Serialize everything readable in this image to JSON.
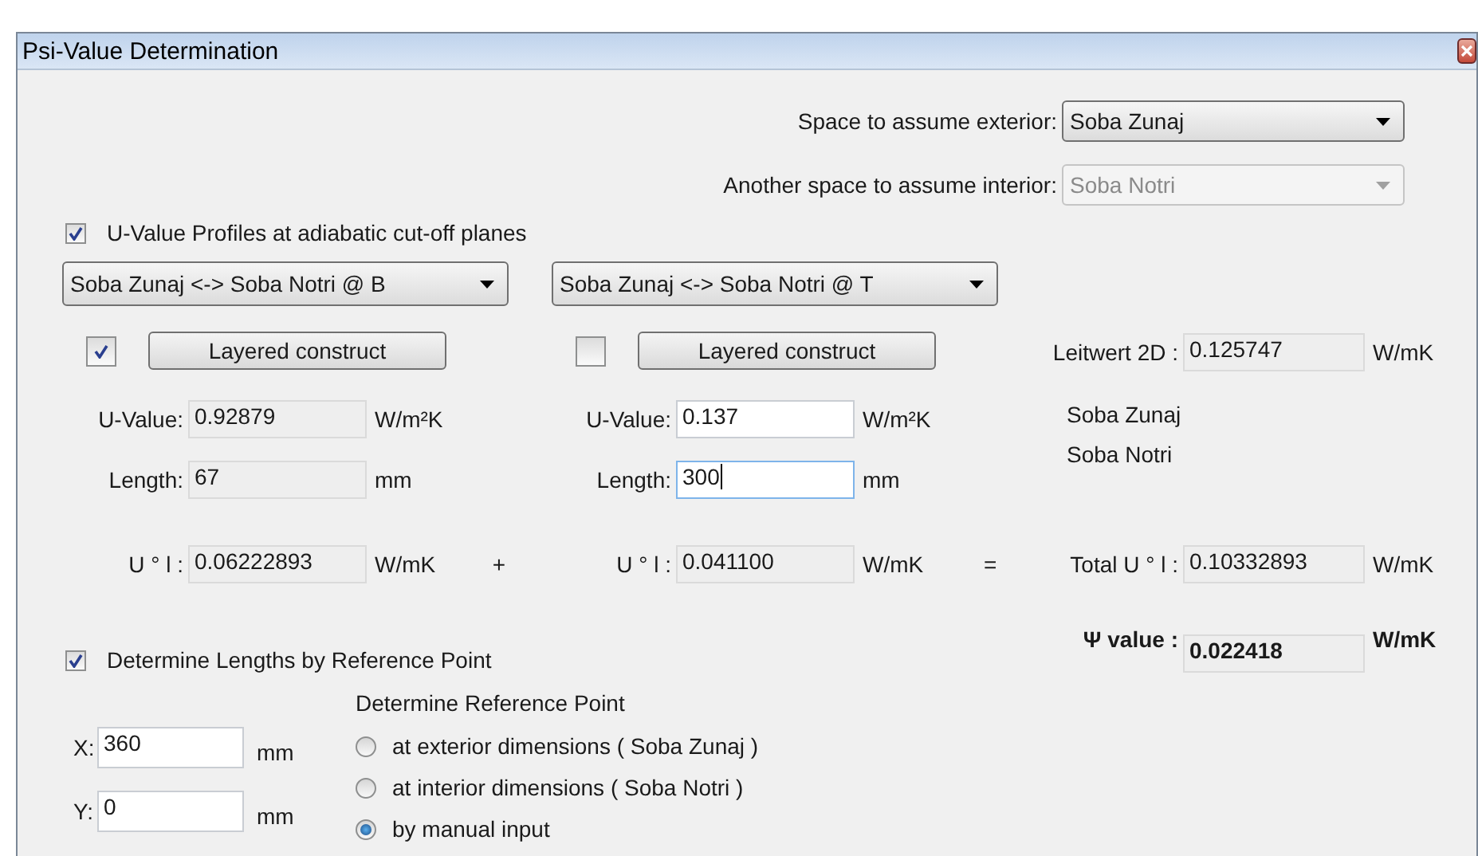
{
  "window": {
    "title": "Psi-Value Determination"
  },
  "exterior": {
    "label": "Space to assume exterior:",
    "value": "Soba Zunaj",
    "disabled": false
  },
  "interior": {
    "label": "Another space to assume interior:",
    "value": "Soba Notri",
    "disabled": true
  },
  "profiles_checkbox": {
    "label": "U-Value Profiles at adiabatic cut-off planes",
    "checked": true
  },
  "profiles": [
    {
      "combo": "Soba Zunaj <-> Soba Notri @ B",
      "layered_checked": true,
      "layered_button": "Layered construct",
      "u_label": "U-Value:",
      "u": {
        "value": "0.92879",
        "readonly": true,
        "focused": false
      },
      "u_unit": "W/m²K",
      "length_label": "Length:",
      "length": {
        "value": "67",
        "readonly": true,
        "focused": false
      },
      "length_unit": "mm",
      "ul_label": "U ° l :",
      "ul": {
        "value": "0.06222893",
        "readonly": true,
        "focused": false
      },
      "ul_unit": "W/mK"
    },
    {
      "combo": "Soba Zunaj <-> Soba Notri @ T",
      "layered_checked": false,
      "layered_button": "Layered construct",
      "u_label": "U-Value:",
      "u": {
        "value": "0.137",
        "readonly": false,
        "focused": false
      },
      "u_unit": "W/m²K",
      "length_label": "Length:",
      "length": {
        "value": "300",
        "readonly": false,
        "focused": true
      },
      "length_unit": "mm",
      "ul_label": "U ° l :",
      "ul": {
        "value": "0.041100",
        "readonly": true,
        "focused": false
      },
      "ul_unit": "W/mK"
    }
  ],
  "plus": "+",
  "equals": "=",
  "leitwert": {
    "label": "Leitwert 2D :",
    "value": "0.125747",
    "unit": "W/mK"
  },
  "spaces": [
    "Soba Zunaj",
    "Soba Notri"
  ],
  "total": {
    "label": "Total U ° l :",
    "value": "0.10332893",
    "unit": "W/mK"
  },
  "psi": {
    "label": "Ψ value :",
    "value": "0.022418",
    "unit": "W/mK"
  },
  "reference_checkbox": {
    "label": "Determine Lengths by Reference Point",
    "checked": true
  },
  "coords": [
    {
      "label": "X:",
      "value": "360",
      "unit": "mm"
    },
    {
      "label": "Y:",
      "value": "0",
      "unit": "mm"
    }
  ],
  "reference": {
    "title": "Determine Reference Point",
    "options": [
      {
        "label": "at exterior dimensions ( Soba Zunaj )",
        "selected": false
      },
      {
        "label": "at interior dimensions ( Soba Notri )",
        "selected": false
      },
      {
        "label": "by manual input",
        "selected": true
      }
    ]
  }
}
